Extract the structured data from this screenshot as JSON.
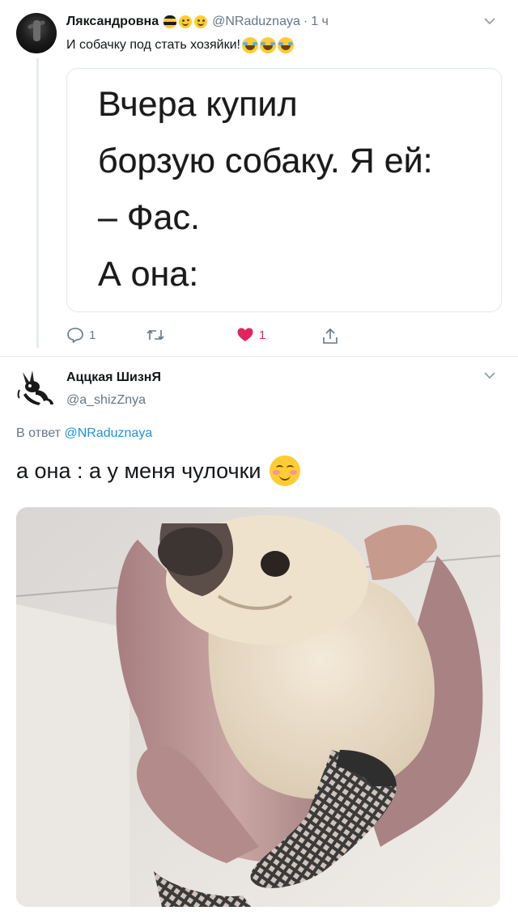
{
  "tweet1": {
    "author_name": "Ляксандровна",
    "author_handle": "@NRaduznaya",
    "time": "1 ч",
    "text": "И собачку под стать хозяйки!",
    "card_lines": [
      "Вчера купил",
      "борзую собаку. Я ей:",
      "– Фас.",
      "А она:"
    ],
    "reply_count": "1",
    "like_count": "1"
  },
  "tweet2": {
    "author_name": "Аццкая ШизнЯ",
    "author_handle": "@a_shizZnya",
    "reply_prefix": "В ответ",
    "reply_to": "@NRaduznaya",
    "text": "а она : а у меня чулочки"
  },
  "colors": {
    "text_primary": "#14171a",
    "text_secondary": "#657786",
    "link": "#1b95e0",
    "like": "#e0245e",
    "border": "#e1e8ed"
  },
  "icons": {
    "reply": "speech-bubble-icon",
    "retweet": "retweet-arrows-icon",
    "like": "heart-icon",
    "share": "upload-icon",
    "menu": "chevron-down-icon"
  }
}
